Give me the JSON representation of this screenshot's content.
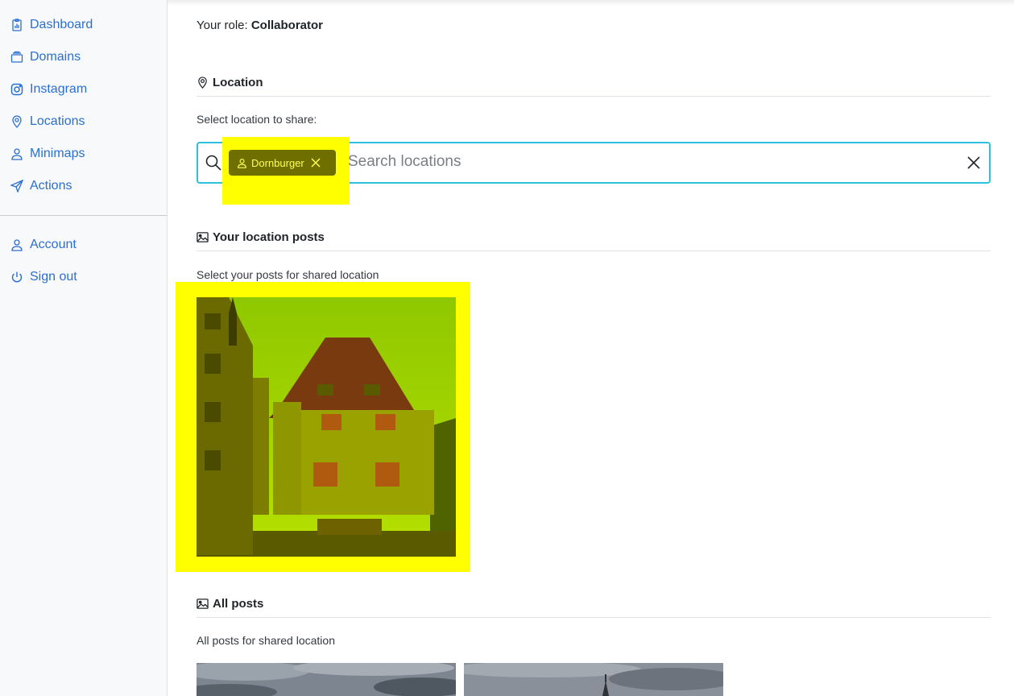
{
  "sidebar": {
    "items": [
      {
        "label": "Dashboard",
        "icon": "dashboard-icon"
      },
      {
        "label": "Domains",
        "icon": "stack-icon"
      },
      {
        "label": "Instagram",
        "icon": "instagram-icon"
      },
      {
        "label": "Locations",
        "icon": "location-pin-icon"
      },
      {
        "label": "Minimaps",
        "icon": "person-icon"
      },
      {
        "label": "Actions",
        "icon": "send-icon"
      }
    ],
    "bottom_items": [
      {
        "label": "Account",
        "icon": "person-icon"
      },
      {
        "label": "Sign out",
        "icon": "power-icon"
      }
    ]
  },
  "main": {
    "role_prefix": "Your role:",
    "role_value": "Collaborator",
    "location_section": {
      "title": "Location",
      "subtitle": "Select location to share:",
      "selected_tag": "Dornburger",
      "search_placeholder": "Search locations"
    },
    "your_posts_section": {
      "title": "Your location posts",
      "subtitle": "Select your posts for shared location"
    },
    "all_posts_section": {
      "title": "All posts",
      "subtitle": "All posts for shared location"
    }
  },
  "colors": {
    "link": "#2b6fd0",
    "search_border": "#2dc1e0",
    "highlight": "#ffff00",
    "tag_bg": "#6f6f00"
  }
}
